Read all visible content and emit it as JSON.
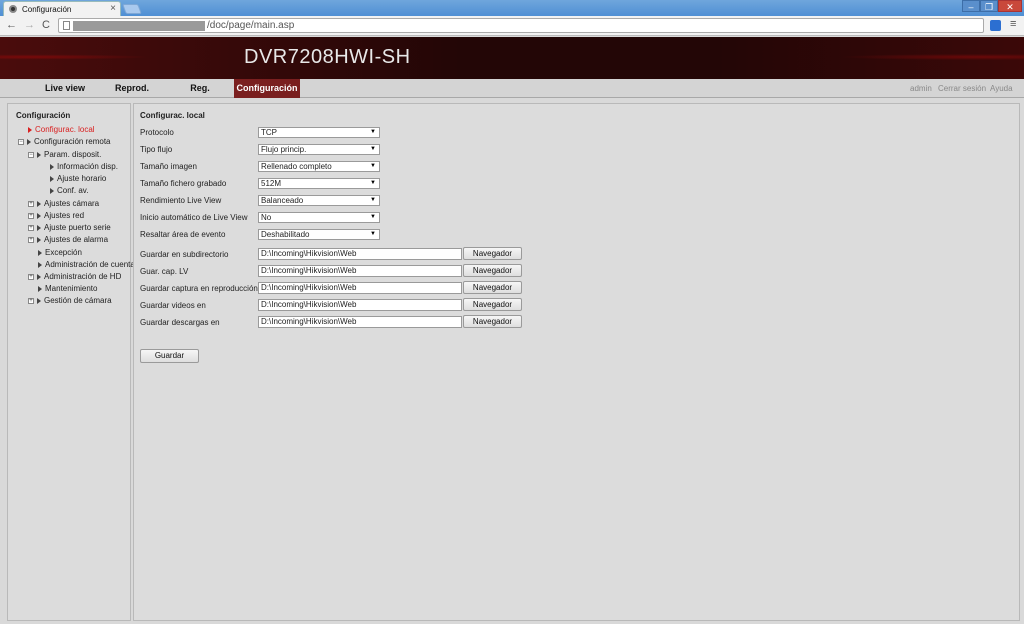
{
  "browser": {
    "tab_title": "Configuración",
    "tab_close": "×",
    "url_path": "/doc/page/main.asp",
    "window_controls": {
      "minimize": "–",
      "maximize": "❐",
      "close": "✕"
    },
    "nav": {
      "back": "←",
      "forward": "→",
      "reload": "C"
    },
    "star": "☆",
    "menu": "≡"
  },
  "app": {
    "title": "DVR7208HWI-SH"
  },
  "topnav": {
    "tabs": [
      {
        "label": "Live view"
      },
      {
        "label": "Reprod."
      },
      {
        "label": "Reg."
      },
      {
        "label": "Configuración"
      }
    ],
    "active_tab": "Configuración",
    "user_links": {
      "admin": "admin",
      "logout": "Cerrar sesión",
      "help": "Ayuda"
    }
  },
  "sidebar": {
    "title": "Configuración",
    "items": [
      {
        "label": "Configurac. local"
      },
      {
        "label": "Configuración remota"
      },
      {
        "label": "Param. disposit."
      },
      {
        "label": "Información disp."
      },
      {
        "label": "Ajuste horario"
      },
      {
        "label": "Conf. av."
      },
      {
        "label": "Ajustes cámara"
      },
      {
        "label": "Ajustes red"
      },
      {
        "label": "Ajuste puerto serie"
      },
      {
        "label": "Ajustes de alarma"
      },
      {
        "label": "Excepción"
      },
      {
        "label": "Administración de cuenta"
      },
      {
        "label": "Administración de HD"
      },
      {
        "label": "Mantenimiento"
      },
      {
        "label": "Gestión de cámara"
      }
    ],
    "expander_plus": "+",
    "expander_minus": "−"
  },
  "main": {
    "title": "Configurac. local",
    "select_rows": [
      {
        "label": "Protocolo",
        "value": "TCP"
      },
      {
        "label": "Tipo flujo",
        "value": "Flujo princip."
      },
      {
        "label": "Tamaño imagen",
        "value": "Rellenado completo"
      },
      {
        "label": "Tamaño fichero grabado",
        "value": "512M"
      },
      {
        "label": "Rendimiento Live View",
        "value": "Balanceado"
      },
      {
        "label": "Inicio automático de Live View",
        "value": "No"
      },
      {
        "label": "Resaltar área de evento",
        "value": "Deshabilitado"
      }
    ],
    "path_rows": [
      {
        "label": "Guardar en subdirectorio",
        "value": "D:\\Incoming\\Hikvision\\Web"
      },
      {
        "label": "Guar. cap. LV",
        "value": "D:\\Incoming\\Hikvision\\Web"
      },
      {
        "label": "Guardar captura en reproducción",
        "value": "D:\\Incoming\\Hikvision\\Web"
      },
      {
        "label": "Guardar videos en",
        "value": "D:\\Incoming\\Hikvision\\Web"
      },
      {
        "label": "Guardar descargas en",
        "value": "D:\\Incoming\\Hikvision\\Web"
      }
    ],
    "browse_label": "Navegador",
    "select_arrow": "▼",
    "save_label": "Guardar"
  },
  "colors": {
    "accent": "#7a1f1f",
    "active_tree": "#d92020",
    "header_bg": "#2a0808"
  }
}
